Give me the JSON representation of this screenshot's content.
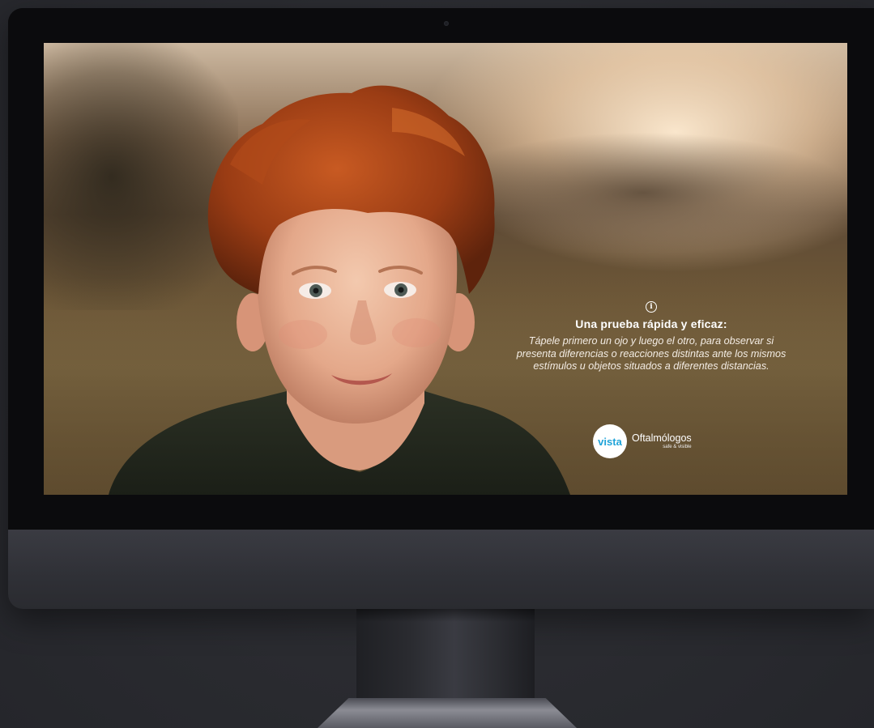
{
  "screen": {
    "info": {
      "icon": "info-icon",
      "title": "Una prueba rápida y eficaz:",
      "body": "Tápele primero un ojo y luego el otro, para observar si presenta diferencias o reacciones distintas ante los mismos estímulos u objetos situados a diferentes distancias."
    },
    "logo": {
      "badge": "vista",
      "name": "Oftalmólogos",
      "tagline": "safe & visible",
      "brand_color": "#1fa3d8"
    }
  }
}
